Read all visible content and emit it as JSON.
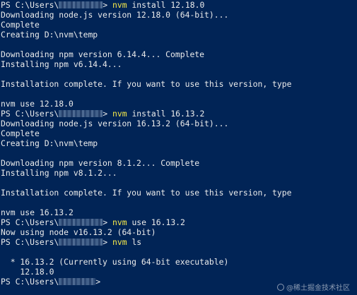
{
  "terminal": {
    "lines": [
      {
        "kind": "prompt",
        "pre": "PS C:\\Users\\",
        "post": "> ",
        "cmd": "nvm",
        "args": " install 12.18.0"
      },
      {
        "kind": "text",
        "text": "Downloading node.js version 12.18.0 (64-bit)..."
      },
      {
        "kind": "text",
        "text": "Complete"
      },
      {
        "kind": "text",
        "text": "Creating D:\\nvm\\temp"
      },
      {
        "kind": "text",
        "text": ""
      },
      {
        "kind": "text",
        "text": "Downloading npm version 6.14.4... Complete"
      },
      {
        "kind": "text",
        "text": "Installing npm v6.14.4..."
      },
      {
        "kind": "text",
        "text": ""
      },
      {
        "kind": "text",
        "text": "Installation complete. If you want to use this version, type"
      },
      {
        "kind": "text",
        "text": ""
      },
      {
        "kind": "text",
        "text": "nvm use 12.18.0"
      },
      {
        "kind": "prompt",
        "pre": "PS C:\\Users\\",
        "post": "> ",
        "cmd": "nvm",
        "args": " install 16.13.2"
      },
      {
        "kind": "text",
        "text": "Downloading node.js version 16.13.2 (64-bit)..."
      },
      {
        "kind": "text",
        "text": "Complete"
      },
      {
        "kind": "text",
        "text": "Creating D:\\nvm\\temp"
      },
      {
        "kind": "text",
        "text": ""
      },
      {
        "kind": "text",
        "text": "Downloading npm version 8.1.2... Complete"
      },
      {
        "kind": "text",
        "text": "Installing npm v8.1.2..."
      },
      {
        "kind": "text",
        "text": ""
      },
      {
        "kind": "text",
        "text": "Installation complete. If you want to use this version, type"
      },
      {
        "kind": "text",
        "text": ""
      },
      {
        "kind": "text",
        "text": "nvm use 16.13.2"
      },
      {
        "kind": "prompt",
        "pre": "PS C:\\Users\\",
        "post": "> ",
        "cmd": "nvm",
        "args": " use 16.13.2"
      },
      {
        "kind": "text",
        "text": "Now using node v16.13.2 (64-bit)"
      },
      {
        "kind": "prompt",
        "pre": "PS C:\\Users\\",
        "post": "> ",
        "cmd": "nvm",
        "args": " ls"
      },
      {
        "kind": "text",
        "text": ""
      },
      {
        "kind": "text",
        "text": "  * 16.13.2 (Currently using 64-bit executable)"
      },
      {
        "kind": "text",
        "text": "    12.18.0"
      },
      {
        "kind": "prompt",
        "pre": "PS C:\\Users\\",
        "post": ">",
        "cmd": "",
        "args": ""
      }
    ]
  },
  "watermark": {
    "text": "@稀土掘金技术社区"
  },
  "colors": {
    "background": "#012456",
    "foreground": "#ebebeb",
    "command": "#f5e84a"
  }
}
